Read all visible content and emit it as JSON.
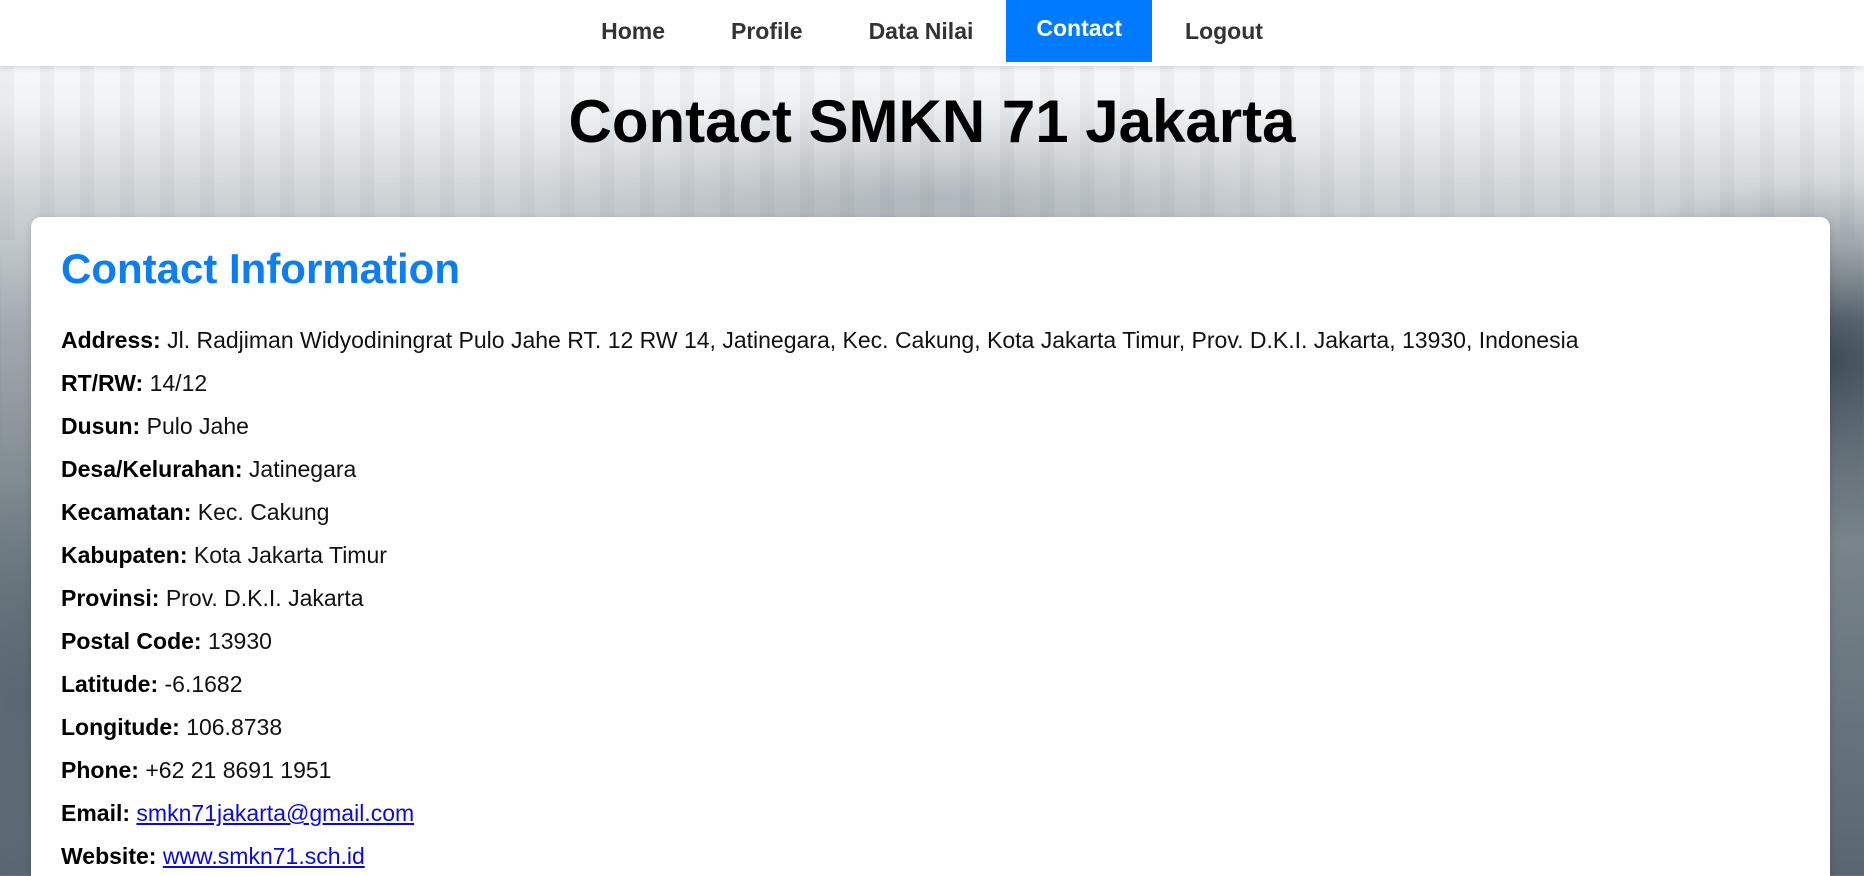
{
  "nav": {
    "items": [
      {
        "label": "Home"
      },
      {
        "label": "Profile"
      },
      {
        "label": "Data Nilai"
      },
      {
        "label": "Contact"
      },
      {
        "label": "Logout"
      }
    ],
    "active_index": 3,
    "active_color": "#007bff"
  },
  "page": {
    "title": "Contact SMKN 71 Jakarta"
  },
  "contact": {
    "heading": "Contact Information",
    "heading_color": "#0d7ef0",
    "fields": [
      {
        "label": "Address:",
        "value": "Jl. Radjiman Widyodiningrat Pulo Jahe RT. 12 RW 14, Jatinegara, Kec. Cakung, Kota Jakarta Timur, Prov. D.K.I. Jakarta, 13930, Indonesia"
      },
      {
        "label": "RT/RW:",
        "value": "14/12"
      },
      {
        "label": "Dusun:",
        "value": "Pulo Jahe"
      },
      {
        "label": "Desa/Kelurahan:",
        "value": "Jatinegara"
      },
      {
        "label": "Kecamatan:",
        "value": "Kec. Cakung"
      },
      {
        "label": "Kabupaten:",
        "value": "Kota Jakarta Timur"
      },
      {
        "label": "Provinsi:",
        "value": "Prov. D.K.I. Jakarta"
      },
      {
        "label": "Postal Code:",
        "value": "13930"
      },
      {
        "label": "Latitude:",
        "value": "-6.1682"
      },
      {
        "label": "Longitude:",
        "value": "106.8738"
      },
      {
        "label": "Phone:",
        "value": "+62 21 8691 1951"
      },
      {
        "label": "Email:",
        "value": "smkn71jakarta@gmail.com"
      },
      {
        "label": "Website:",
        "value": "www.smkn71.sch.id"
      }
    ]
  }
}
